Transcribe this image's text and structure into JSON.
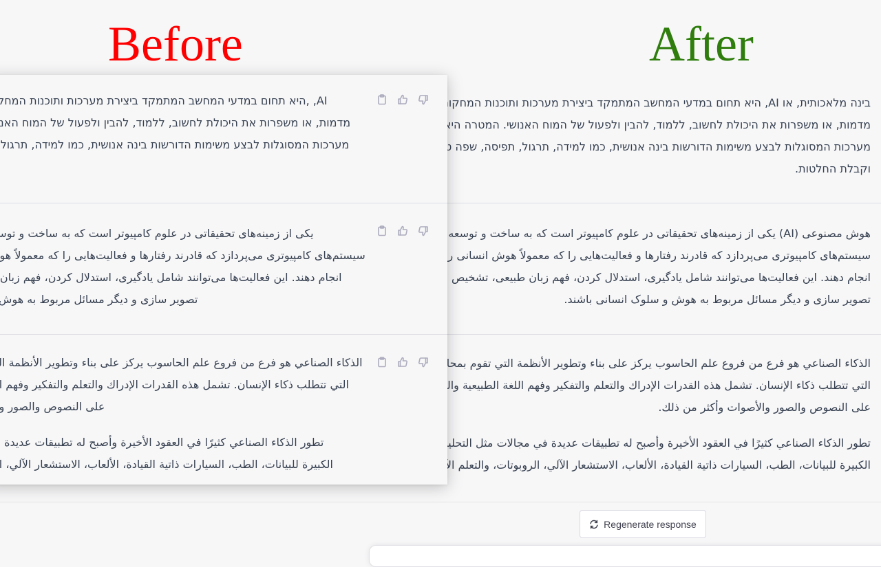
{
  "headings": {
    "before": "Before",
    "after": "After"
  },
  "after": {
    "blocks": [
      {
        "lines": [
          "בינה מלאכותית, או AI, היא תחום במדעי המחשב המתמקד ביצירת מערכות ותוכנות המחקות, או",
          "מדמות, או משפרות את היכולת לחשוב, ללמוד, להבין ולפעול של המוח האנושי. המטרה היא לפתח",
          "מערכות המסוגלות לבצע משימות הדורשות בינה אנושית, כמו למידה, תרגול, תפיסה, שפה טבעית",
          "וקבלת החלטות."
        ]
      },
      {
        "lines": [
          "هوش مصنوعی (AI) یکی از زمینه‌های تحقیقاتی در علوم کامپیوتر است که به ساخت و توسعه",
          "سیستم‌های کامپیوتری می‌پردازد که قادرند رفتارها و فعالیت‌هایی را که معمولاً هوش انسانی را نیاز دارند،",
          "انجام دهند. این فعالیت‌ها می‌توانند شامل یادگیری، استدلال کردن، فهم زبان طبیعی، تشخیص صدا،",
          "تصویر سازی و دیگر مسائل مربوط به هوش و سلوک انسانی باشند."
        ]
      },
      {
        "lines": [
          "الذكاء الصناعي هو فرع من فروع علم الحاسوب يركز على بناء وتطوير الأنظمة التي تقوم بمحاكاة المهام",
          "التي تتطلب ذكاء الإنسان. تشمل هذه القدرات الإدراك والتعلم والتفكير وفهم اللغة الطبيعية والتعرف",
          "على النصوص والصور والأصوات وأكثر من ذلك."
        ],
        "lines2": [
          "تطور الذكاء الصناعي كثيرًا في العقود الأخيرة وأصبح له تطبيقات عديدة في مجالات مثل التحليلات",
          "الكبيرة للبيانات، الطب، السيارات ذاتية القيادة، الألعاب، الاستشعار الآلي، الروبوتات، والتعلم الآلي."
        ]
      }
    ]
  },
  "before": {
    "blocks": [
      {
        "lines": [
          "היא תחום במדעי המחשב המתמקד ביצירת מערכות ותוכנות המחקות, ,AI",
          "מדמות, או משפרות את היכולת לחשוב, ללמוד, להבין ולפעול של המוח האנושי",
          "מערכות המסוגלות לבצע משימות הדורשות בינה אנושית, כמו למידה, תרגול, ת"
        ]
      },
      {
        "lines": [
          "یکی از زمینه‌های تحقیقاتی در علوم کامپیوتر است که به ساخت و توسعه",
          "سیستم‌های کامپیوتری می‌پردازد که قادرند رفتارها و فعالیت‌هایی را که معمولاً هوش",
          "انجام دهند. این فعالیت‌ها می‌توانند شامل یادگیری، استدلال کردن، فهم زبان ط",
          ".تصویر سازی و دیگر مسائل مربوط به هوش و"
        ]
      },
      {
        "lines": [
          "الذكاء الصناعي هو فرع من فروع علم الحاسوب يركز على بناء وتطوير الأنظمة التي",
          "التي تتطلب ذكاء الإنسان. تشمل هذه القدرات الإدراك والتعلم والتفكير وفهم اللغ",
          ".على النصوص والصور والأ"
        ],
        "lines2": [
          "تطور الذكاء الصناعي كثيرًا في العقود الأخيرة وأصبح له تطبيقات عديدة في",
          ".الكبيرة للبيانات، الطب، السيارات ذاتية القيادة، الألعاب، الاستشعار الآلي، الر"
        ]
      }
    ]
  },
  "actions": {
    "icons": [
      "clipboard-icon",
      "thumbs-up-icon",
      "thumbs-down-icon"
    ]
  },
  "bottom": {
    "regenerate_label": "Regenerate response"
  }
}
